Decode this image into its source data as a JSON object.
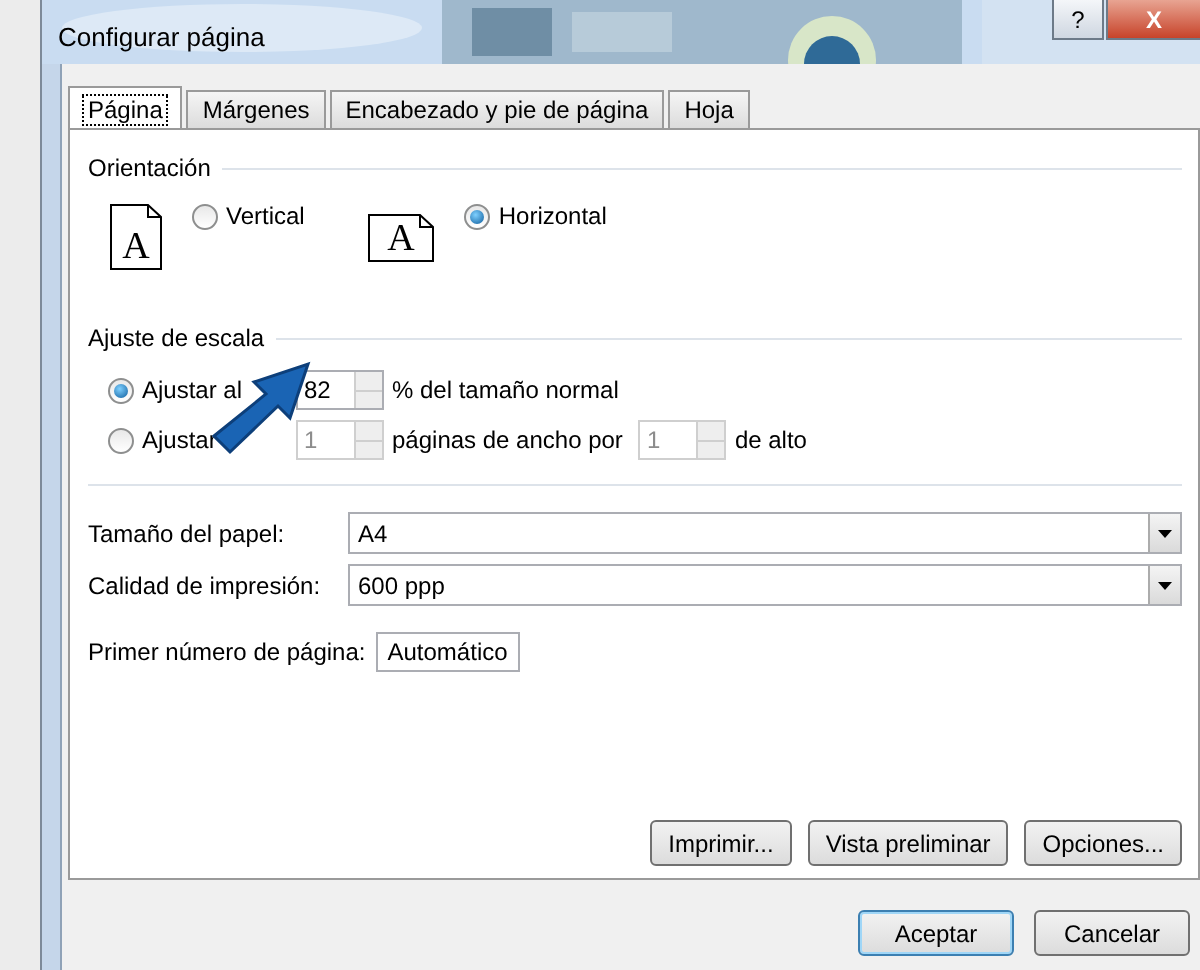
{
  "window": {
    "title": "Configurar página",
    "help": "?",
    "close": "X"
  },
  "tabs": [
    {
      "label": "Página",
      "selected": true
    },
    {
      "label": "Márgenes",
      "selected": false
    },
    {
      "label": "Encabezado y pie de página",
      "selected": false
    },
    {
      "label": "Hoja",
      "selected": false
    }
  ],
  "orientation": {
    "label": "Orientación",
    "options": [
      {
        "label": "Vertical",
        "kind": "portrait",
        "icon_text": "A",
        "selected": false
      },
      {
        "label": "Horizontal",
        "kind": "landscape",
        "icon_text": "A",
        "selected": true
      }
    ]
  },
  "scaling": {
    "label": "Ajuste de escala",
    "options": [
      {
        "kind": "percent",
        "label": "Ajustar al",
        "selected": true,
        "disabled": false,
        "value": "82",
        "suffix": "% del tamaño normal"
      },
      {
        "kind": "pages",
        "label": "Ajustar",
        "selected": false,
        "disabled": true,
        "wide_value": "1",
        "wide_suffix": "páginas de ancho por",
        "tall_value": "1",
        "tall_suffix": "de alto"
      }
    ]
  },
  "paper_size": {
    "label": "Tamaño del papel:",
    "value": "A4"
  },
  "print_quality": {
    "label": "Calidad de impresión:",
    "value": "600 ppp"
  },
  "first_page_number": {
    "label": "Primer número de página:",
    "value": "Automático"
  },
  "panel_buttons": [
    "Imprimir...",
    "Vista preliminar",
    "Opciones..."
  ],
  "footer_buttons": [
    {
      "label": "Aceptar",
      "default": true
    },
    {
      "label": "Cancelar",
      "default": false
    }
  ]
}
